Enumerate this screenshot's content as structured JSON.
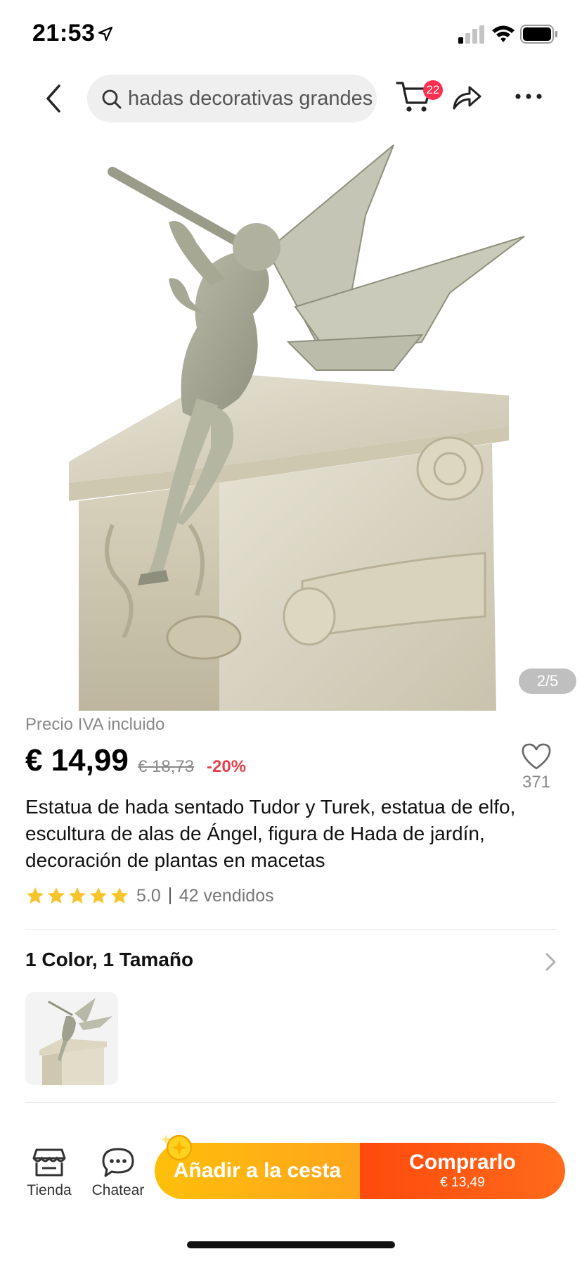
{
  "status_bar": {
    "time": "21:53"
  },
  "nav": {
    "search_query": "hadas decorativas grandes",
    "cart_count": "22"
  },
  "gallery": {
    "counter": "2/5"
  },
  "product": {
    "vat_note": "Precio IVA incluido",
    "price": "€ 14,99",
    "old_price": "€ 18,73",
    "discount": "-20%",
    "wishlist_count": "371",
    "title": "Estatua de hada sentado Tudor y Turek, estatua de elfo, escultura de alas de Ángel, figura de Hada de jardín, decoración de plantas en macetas",
    "rating": "5.0",
    "stars": 5,
    "sold": "42 vendidos"
  },
  "variants": {
    "title": "1 Color, 1 Tamaño"
  },
  "bottom_bar": {
    "store_label": "Tienda",
    "chat_label": "Chatear",
    "add_to_cart_label": "Añadir a la cesta",
    "buy_label": "Comprarlo",
    "buy_price": "€ 13,49"
  },
  "colors": {
    "accent_orange": "#ff4a0d",
    "accent_yellow": "#ffbf0a",
    "discount_red": "#e8414c",
    "badge_red": "#ff2f4f",
    "star_yellow": "#f7c52b"
  }
}
